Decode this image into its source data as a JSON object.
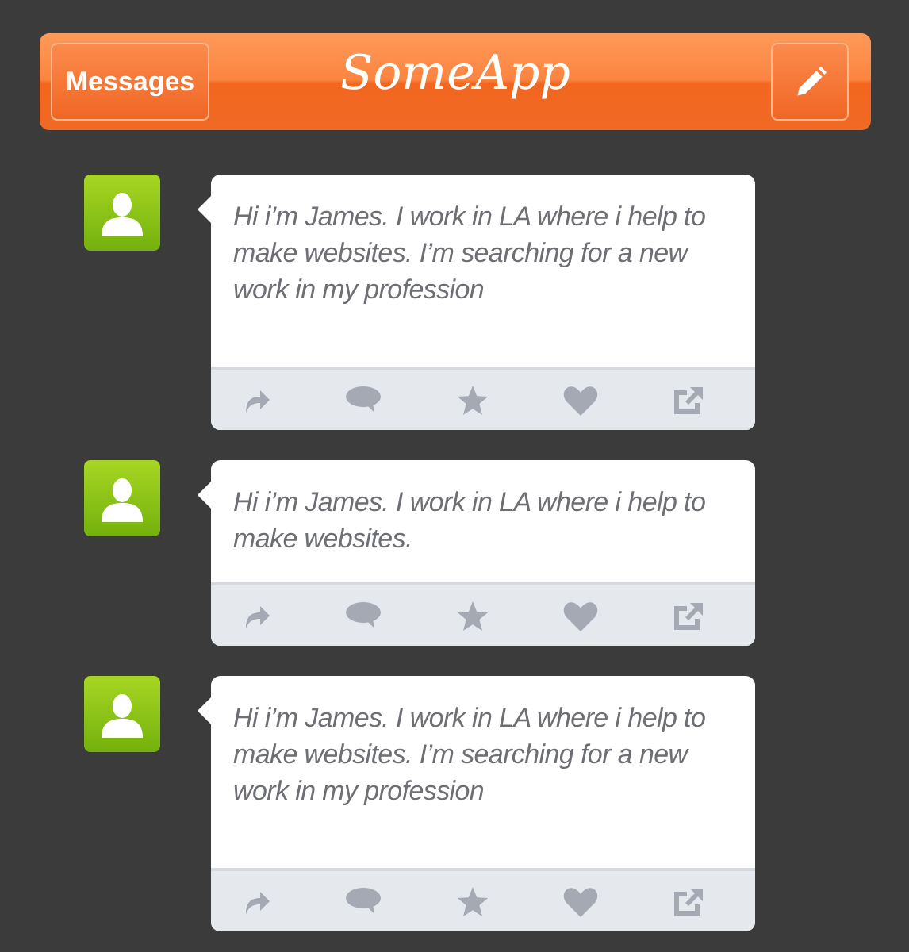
{
  "header": {
    "button": "Messages",
    "title": "SomeApp"
  },
  "posts": [
    {
      "text": "Hi i’m James. I work in LA where i help to make websites. I’m searching for a new work in my profession"
    },
    {
      "text": "Hi i’m James. I work in LA where i help to make websites."
    },
    {
      "text": "Hi i’m James. I work in LA where i help to make websites. I’m searching for a new work in my profession"
    }
  ]
}
